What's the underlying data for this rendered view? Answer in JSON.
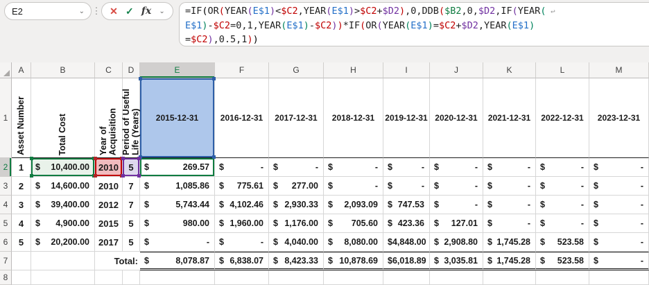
{
  "formula_bar": {
    "name_box": "E2",
    "name_box_chevron": "⌄",
    "dots_divider": "⋮",
    "cancel_icon": "✕",
    "enter_icon": "✓",
    "fx_label": "fx",
    "fx_chevron": "⌄",
    "wrap_icon": "↩",
    "formula_lines": [
      "=IF(OR(YEAR(E$1)<$C2,YEAR(E$1)>$C2+$D2),0,DDB($B2,0,$D2,IF(YEAR(",
      "E$1)-$C2=0,1,YEAR(E$1)-$C2))*IF(OR(YEAR(E$1)=$C2+$D2,YEAR(E$1)",
      "=$C2),0.5,1))"
    ]
  },
  "colors": {
    "accent_green": "#107C41",
    "ref_colors": {
      "E$1": "#2470C8",
      "$C2": "#C00000",
      "$D2": "#7030A0",
      "$B2": "#107C41"
    },
    "paren_palette": [
      "#000000",
      "#C00000",
      "#7030A0",
      "#00835C"
    ]
  },
  "grid": {
    "column_letters": [
      "A",
      "B",
      "C",
      "D",
      "E",
      "F",
      "G",
      "H",
      "I",
      "J",
      "K",
      "L",
      "M"
    ],
    "selected_column": "E",
    "row_numbers": [
      "1",
      "2",
      "3",
      "4",
      "5",
      "6",
      "7",
      "8"
    ],
    "selected_row": "2",
    "rotated_headers": [
      {
        "col": "A",
        "lines": [
          "Asset Number"
        ]
      },
      {
        "col": "B",
        "lines": [
          "Total Cost"
        ]
      },
      {
        "col": "C",
        "lines": [
          "Year of",
          "Acquisition"
        ]
      },
      {
        "col": "D",
        "lines": [
          "Period of Useful",
          "Life (Years)"
        ]
      }
    ],
    "date_headers": [
      "2015-12-31",
      "2016-12-31",
      "2017-12-31",
      "2018-12-31",
      "2019-12-31",
      "2020-12-31",
      "2021-12-31",
      "2022-12-31",
      "2023-12-31"
    ],
    "currency_symbol": "$",
    "rows": [
      {
        "asset": "1",
        "cost": "10,400.00",
        "year": "2010",
        "life": "5",
        "dep": [
          "269.57",
          "-",
          "-",
          "-",
          "-",
          "-",
          "-",
          "-",
          "-"
        ]
      },
      {
        "asset": "2",
        "cost": "14,600.00",
        "year": "2010",
        "life": "7",
        "dep": [
          "1,085.86",
          "775.61",
          "277.00",
          "-",
          "-",
          "-",
          "-",
          "-",
          "-"
        ]
      },
      {
        "asset": "3",
        "cost": "39,400.00",
        "year": "2012",
        "life": "7",
        "dep": [
          "5,743.44",
          "4,102.46",
          "2,930.33",
          "2,093.09",
          "747.53",
          "-",
          "-",
          "-",
          "-"
        ]
      },
      {
        "asset": "4",
        "cost": "4,900.00",
        "year": "2015",
        "life": "5",
        "dep": [
          "980.00",
          "1,960.00",
          "1,176.00",
          "705.60",
          "423.36",
          "127.01",
          "-",
          "-",
          "-"
        ]
      },
      {
        "asset": "5",
        "cost": "20,200.00",
        "year": "2017",
        "life": "5",
        "dep": [
          "-",
          "-",
          "4,040.00",
          "8,080.00",
          "4,848.00",
          "2,908.80",
          "1,745.28",
          "523.58",
          "-"
        ]
      }
    ],
    "total_row": {
      "label": "Total:",
      "values": [
        "8,078.87",
        "6,838.07",
        "8,423.33",
        "10,878.69",
        "6,018.89",
        "3,035.81",
        "1,745.28",
        "523.58",
        "-"
      ]
    }
  }
}
